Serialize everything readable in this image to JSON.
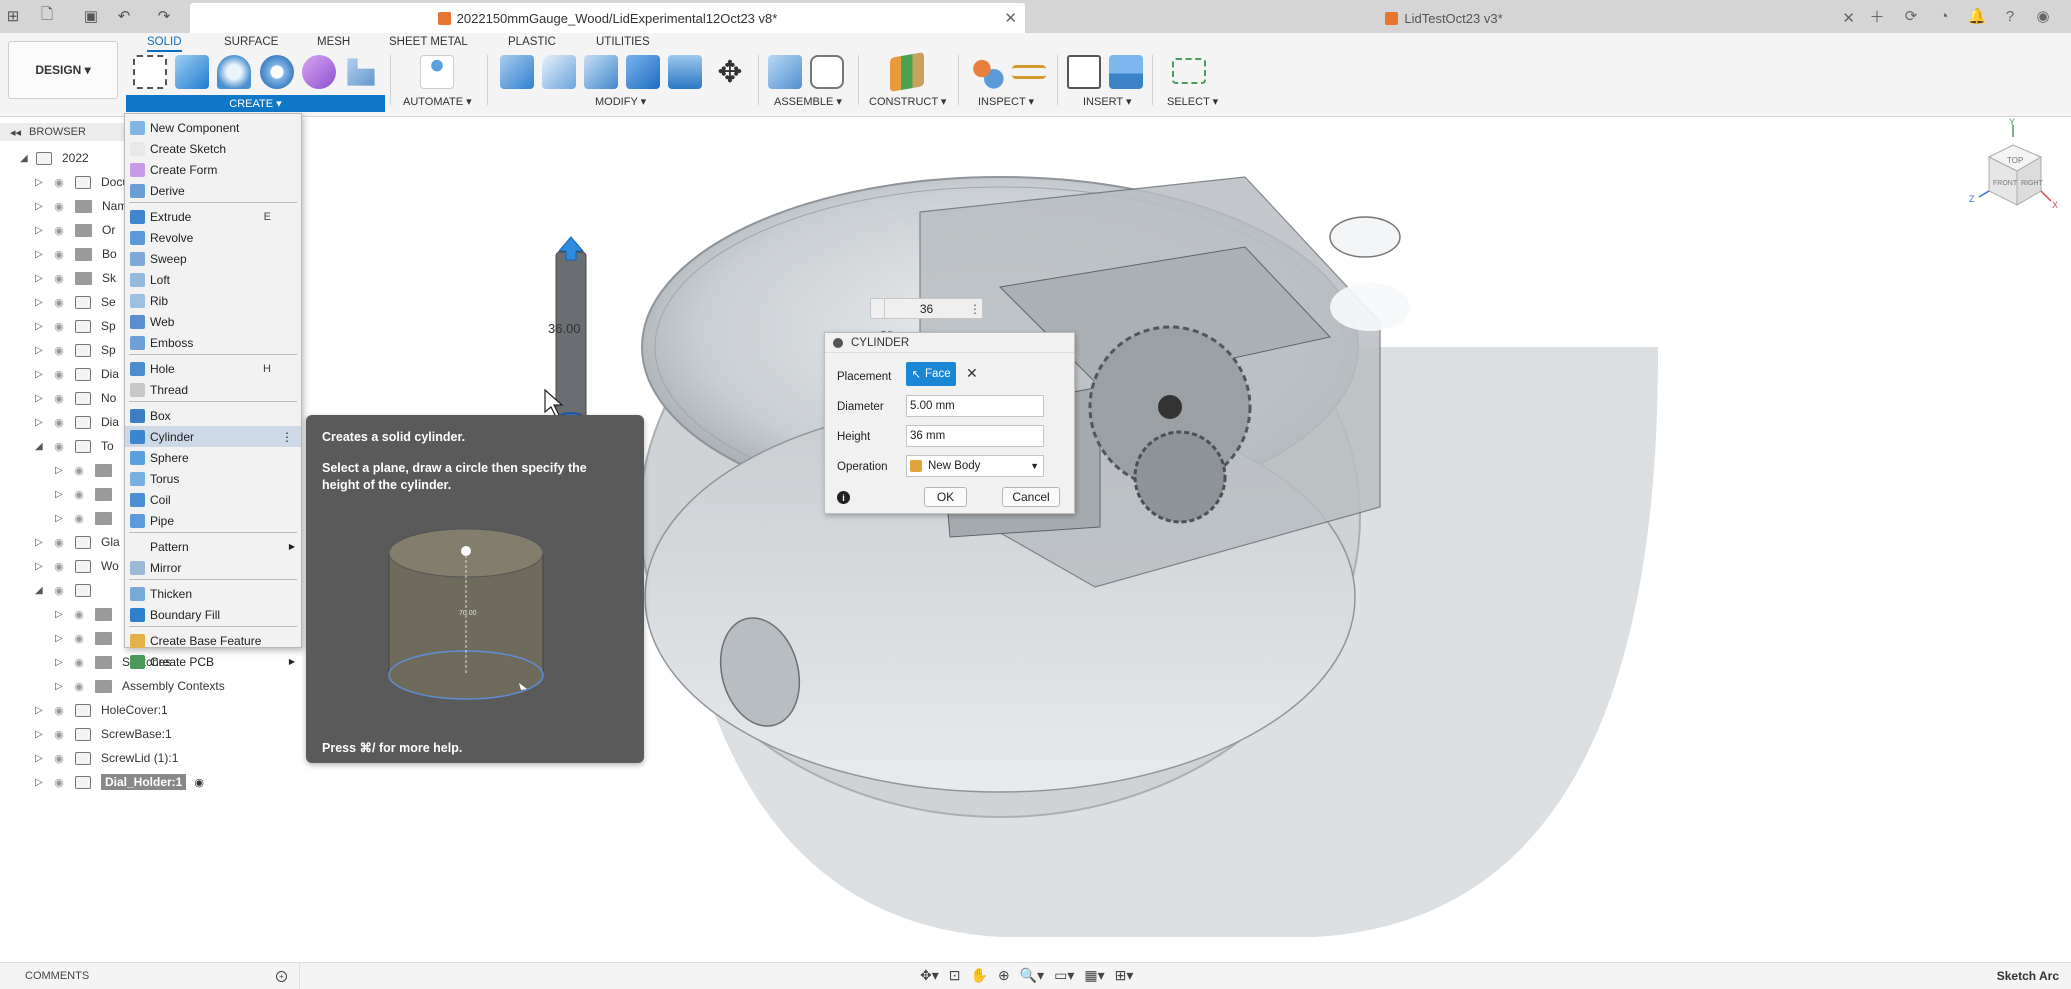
{
  "tabs": {
    "active_title": "2022150mmGauge_Wood/LidExperimental12Oct23 v8*",
    "inactive_title": "LidTestOct23 v3*"
  },
  "toolbar": {
    "workspace": "DESIGN ▾",
    "ws_tabs": [
      "SOLID",
      "SURFACE",
      "MESH",
      "SHEET METAL",
      "PLASTIC",
      "UTILITIES"
    ],
    "groups": [
      "CREATE ▾",
      "AUTOMATE ▾",
      "MODIFY ▾",
      "ASSEMBLE ▾",
      "CONSTRUCT ▾",
      "INSPECT ▾",
      "INSERT ▾",
      "SELECT ▾"
    ]
  },
  "browser": {
    "header": "BROWSER",
    "items": [
      "2022",
      "Docume",
      "Named",
      "Or",
      "Bo",
      "Sk",
      "Se",
      "Sp",
      "Sp",
      "Dia",
      "No",
      "Dia",
      "To",
      "",
      "",
      "",
      "Gla",
      "Wo",
      "",
      "",
      "",
      "Sketches",
      "Assembly Contexts",
      "HoleCover:1",
      "ScrewBase:1",
      "ScrewLid (1):1",
      "Dial_Holder:1"
    ]
  },
  "create_menu": {
    "items": [
      {
        "label": "New Component",
        "shortcut": ""
      },
      {
        "label": "Create Sketch",
        "shortcut": ""
      },
      {
        "label": "Create Form",
        "shortcut": ""
      },
      {
        "label": "Derive",
        "shortcut": ""
      },
      {
        "label": "Extrude",
        "shortcut": "E"
      },
      {
        "label": "Revolve",
        "shortcut": ""
      },
      {
        "label": "Sweep",
        "shortcut": ""
      },
      {
        "label": "Loft",
        "shortcut": ""
      },
      {
        "label": "Rib",
        "shortcut": ""
      },
      {
        "label": "Web",
        "shortcut": ""
      },
      {
        "label": "Emboss",
        "shortcut": ""
      },
      {
        "label": "Hole",
        "shortcut": "H"
      },
      {
        "label": "Thread",
        "shortcut": ""
      },
      {
        "label": "Box",
        "shortcut": ""
      },
      {
        "label": "Cylinder",
        "shortcut": ""
      },
      {
        "label": "Sphere",
        "shortcut": ""
      },
      {
        "label": "Torus",
        "shortcut": ""
      },
      {
        "label": "Coil",
        "shortcut": ""
      },
      {
        "label": "Pipe",
        "shortcut": ""
      },
      {
        "label": "Pattern",
        "shortcut": ""
      },
      {
        "label": "Mirror",
        "shortcut": ""
      },
      {
        "label": "Thicken",
        "shortcut": ""
      },
      {
        "label": "Boundary Fill",
        "shortcut": ""
      },
      {
        "label": "Create Base Feature",
        "shortcut": ""
      },
      {
        "label": "Create PCB",
        "shortcut": ""
      }
    ]
  },
  "tooltip": {
    "title": "Creates a solid cylinder.",
    "body": "Select a plane, draw a circle then specify the height of the cylinder.",
    "help": "Press ⌘/ for more help.",
    "image_dim": "70.00"
  },
  "dialog": {
    "title": "CYLINDER",
    "placement_label": "Placement",
    "placement_value": "Face",
    "diameter_label": "Diameter",
    "diameter_value": "5.00 mm",
    "height_label": "Height",
    "height_value": "36 mm",
    "operation_label": "Operation",
    "operation_value": "New Body",
    "ok": "OK",
    "cancel": "Cancel"
  },
  "viewport": {
    "mini_input": "36",
    "dim_label": "36.00",
    "viewcube_top": "TOP",
    "viewcube_front": "FRONT",
    "viewcube_right": "RIGHT",
    "axis_y": "Y",
    "axis_x": "X",
    "axis_z": "Z"
  },
  "bottom": {
    "comments": "COMMENTS",
    "status": "Sketch Arc"
  },
  "colors": {
    "accent": "#0f77c8",
    "tab_bg": "#d5d5d5"
  }
}
